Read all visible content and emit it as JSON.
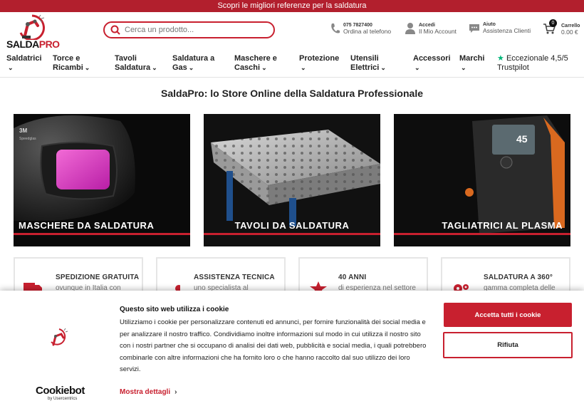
{
  "topbar": {
    "text": "Scopri le migliori referenze per la saldatura"
  },
  "logo": {
    "text_a": "SALDA",
    "text_b": "PRO"
  },
  "search": {
    "placeholder": "Cerca un prodotto..."
  },
  "header": {
    "phone": {
      "line1": "075 7827400",
      "line2": "Ordina al telefono"
    },
    "account": {
      "line1": "Accedi",
      "line2": "Il Mio Account"
    },
    "help": {
      "line1": "Aiuto",
      "line2": "Assistenza Clienti"
    },
    "cart": {
      "count": "0",
      "line1": "Carrello",
      "line2": "0.00 €"
    }
  },
  "nav": {
    "items": [
      {
        "l1": "Saldatrici",
        "l2": ""
      },
      {
        "l1": "Torce e",
        "l2": "Ricambi"
      },
      {
        "l1": "Tavoli",
        "l2": "Saldatura"
      },
      {
        "l1": "Saldatura a",
        "l2": "Gas"
      },
      {
        "l1": "Maschere e",
        "l2": "Caschi"
      },
      {
        "l1": "Protezione",
        "l2": ""
      },
      {
        "l1": "Utensili",
        "l2": "Elettrici"
      },
      {
        "l1": "Accessori",
        "l2": ""
      },
      {
        "l1": "Marchi",
        "l2": ""
      }
    ],
    "trustpilot": {
      "l1": "Eccezionale 4,5/5",
      "l2": "Trustpilot"
    }
  },
  "page": {
    "title": "SaldaPro: lo Store Online della Saldatura Professionale"
  },
  "categories": [
    {
      "label": "MASCHERE DA SALDATURA",
      "brand": "3M",
      "brand_sub": "Speedglas"
    },
    {
      "label": "TAVOLI DA SALDATURA"
    },
    {
      "label": "TAGLIATRICI AL PLASMA",
      "display": "45"
    }
  ],
  "features": [
    {
      "title": "SPEDIZIONE GRATUITA",
      "sub": "ovunque in Italia con"
    },
    {
      "title": "ASSISTENZA TECNICA",
      "sub": "uno specialista al"
    },
    {
      "title": "40 ANNI",
      "sub": "di esperienza nel settore"
    },
    {
      "title": "SALDATURA A 360°",
      "sub": "gamma completa delle"
    }
  ],
  "cookie": {
    "title": "Questo sito web utilizza i cookie",
    "text": "Utilizziamo i cookie per personalizzare contenuti ed annunci, per fornire funzionalità dei social media e per analizzare il nostro traffico. Condividiamo inoltre informazioni sul modo in cui utilizza il nostro sito con i nostri partner che si occupano di analisi dei dati web, pubblicità e social media, i quali potrebbero combinarle con altre informazioni che ha fornito loro o che hanno raccolto dal suo utilizzo dei loro servizi.",
    "more": "Mostra dettagli",
    "accept": "Accetta tutti i cookie",
    "reject": "Rifiuta",
    "brand": "Cookiebot",
    "brand_by": "by Usercentrics"
  },
  "colors": {
    "brand_red": "#c8202f",
    "topbar_red": "#b21f2d",
    "trustpilot_green": "#00b67a"
  }
}
